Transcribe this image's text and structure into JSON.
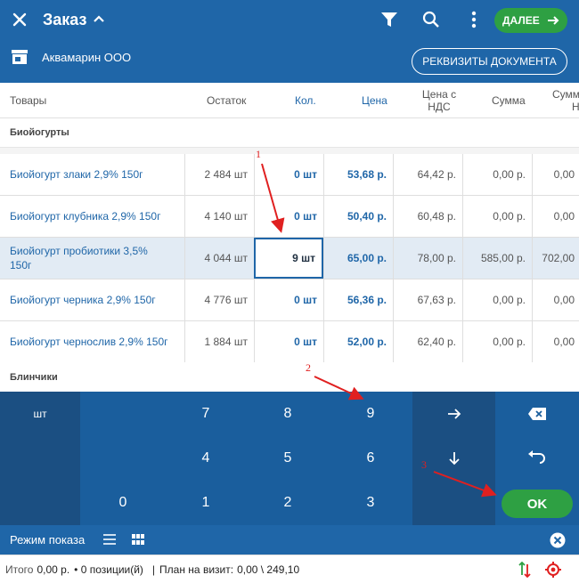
{
  "header": {
    "title": "Заказ",
    "next_label": "ДАЛЕЕ",
    "customer": "Аквамарин ООО",
    "requisites_label": "РЕКВИЗИТЫ ДОКУМЕНТА"
  },
  "table": {
    "columns": {
      "goods": "Товары",
      "stock": "Остаток",
      "qty": "Кол.",
      "price": "Цена",
      "price_vat_1": "Цена с",
      "price_vat_2": "НДС",
      "sum": "Сумма",
      "sum_vat_1": "Сумм",
      "sum_vat_2": "Н"
    },
    "group1": "Биойогурты",
    "group2": "Блинчики",
    "rows": [
      {
        "name": "Биойогурт злаки 2,9% 150г",
        "stock": "2 484 шт",
        "qty": "0 шт",
        "price": "53,68 р.",
        "price_vat": "64,42 р.",
        "sum": "0,00 р.",
        "sum_vat": "0,00"
      },
      {
        "name": "Биойогурт клубника 2,9% 150г",
        "stock": "4 140 шт",
        "qty": "0 шт",
        "price": "50,40 р.",
        "price_vat": "60,48 р.",
        "sum": "0,00 р.",
        "sum_vat": "0,00"
      },
      {
        "name": "Биойогурт пробиотики 3,5% 150г",
        "stock": "4 044 шт",
        "qty": "9 шт",
        "price": "65,00 р.",
        "price_vat": "78,00 р.",
        "sum": "585,00 р.",
        "sum_vat": "702,00"
      },
      {
        "name": "Биойогурт черника 2,9% 150г",
        "stock": "4 776 шт",
        "qty": "0 шт",
        "price": "56,36 р.",
        "price_vat": "67,63 р.",
        "sum": "0,00 р.",
        "sum_vat": "0,00"
      },
      {
        "name": "Биойогурт чернослив 2,9% 150г",
        "stock": "1 884 шт",
        "qty": "0 шт",
        "price": "52,00 р.",
        "price_vat": "62,40 р.",
        "sum": "0,00 р.",
        "sum_vat": "0,00"
      }
    ]
  },
  "keypad": {
    "unit": "шт",
    "keys": {
      "k7": "7",
      "k8": "8",
      "k9": "9",
      "k4": "4",
      "k5": "5",
      "k6": "6",
      "k0": "0",
      "k1": "1",
      "k2": "2",
      "k3": "3"
    },
    "ok_label": "OK"
  },
  "modebar": {
    "label": "Режим показа"
  },
  "footer": {
    "total_label": "Итого",
    "total_value": "0,00 р.",
    "positions": "• 0 позиции(й)",
    "separator": "|",
    "plan_label": "План на визит:",
    "plan_value": "0,00 \\ 249,10"
  },
  "annotations": {
    "n1": "1",
    "n2": "2",
    "n3": "3"
  },
  "colors": {
    "primary": "#1f66a8",
    "accent_green": "#2ea043",
    "annotation_red": "#e02020"
  }
}
